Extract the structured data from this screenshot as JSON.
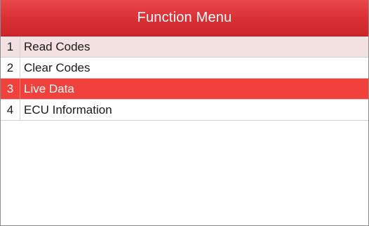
{
  "header": {
    "title": "Function Menu"
  },
  "menu": {
    "items": [
      {
        "number": "1",
        "label": "Read Codes"
      },
      {
        "number": "2",
        "label": "Clear Codes"
      },
      {
        "number": "3",
        "label": "Live Data"
      },
      {
        "number": "4",
        "label": "ECU Information"
      }
    ],
    "selected_index": 2
  },
  "colors": {
    "title_bar": "#d92f34",
    "selected_row": "#f1413c",
    "first_row": "#f2e1e0"
  }
}
